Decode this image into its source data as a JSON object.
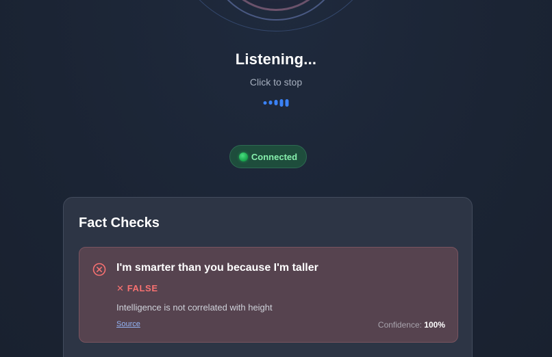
{
  "listening": {
    "title": "Listening...",
    "subtitle": "Click to stop",
    "wave_bars": [
      {
        "level": 0.35
      },
      {
        "level": 0.45
      },
      {
        "level": 0.6
      },
      {
        "level": 0.8
      },
      {
        "level": 0.8
      }
    ],
    "accent_color": "#3b82f6"
  },
  "connection": {
    "label": "Connected",
    "status_color": "#22c55e"
  },
  "fact_checks": {
    "heading": "Fact Checks",
    "items": [
      {
        "icon": "x-circle-icon",
        "claim": "I'm smarter than you because I'm taller",
        "verdict": "✕ FALSE",
        "explanation": "Intelligence is not correlated with height",
        "source_label": "Source",
        "confidence_label": "Confidence:",
        "confidence_value": "100%",
        "verdict_color": "#f87171"
      }
    ]
  }
}
